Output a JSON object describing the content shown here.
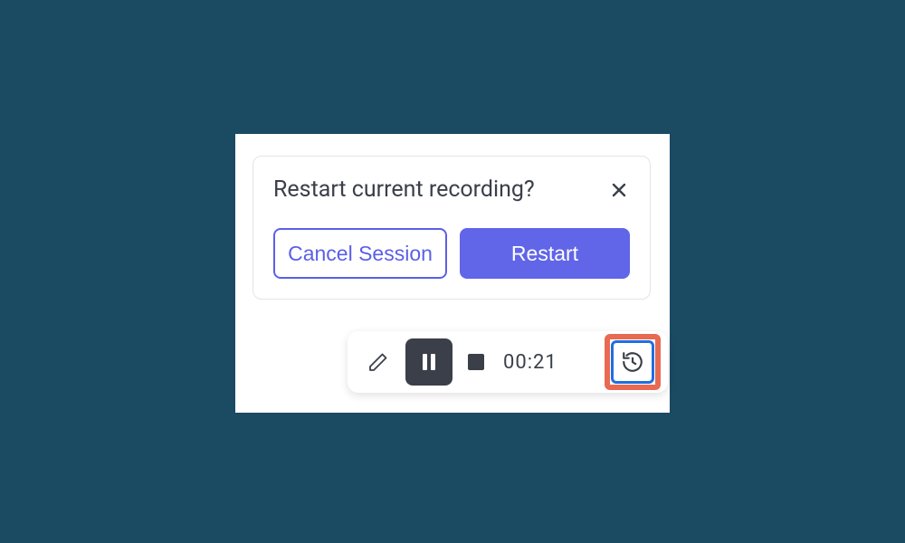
{
  "dialog": {
    "title": "Restart current recording?",
    "cancel_label": "Cancel Session",
    "restart_label": "Restart"
  },
  "toolbar": {
    "timer": "00:21"
  },
  "colors": {
    "background": "#1b4a63",
    "accent": "#6165e8",
    "highlight_outer": "#e86a53",
    "highlight_inner": "#1f6fe0"
  }
}
